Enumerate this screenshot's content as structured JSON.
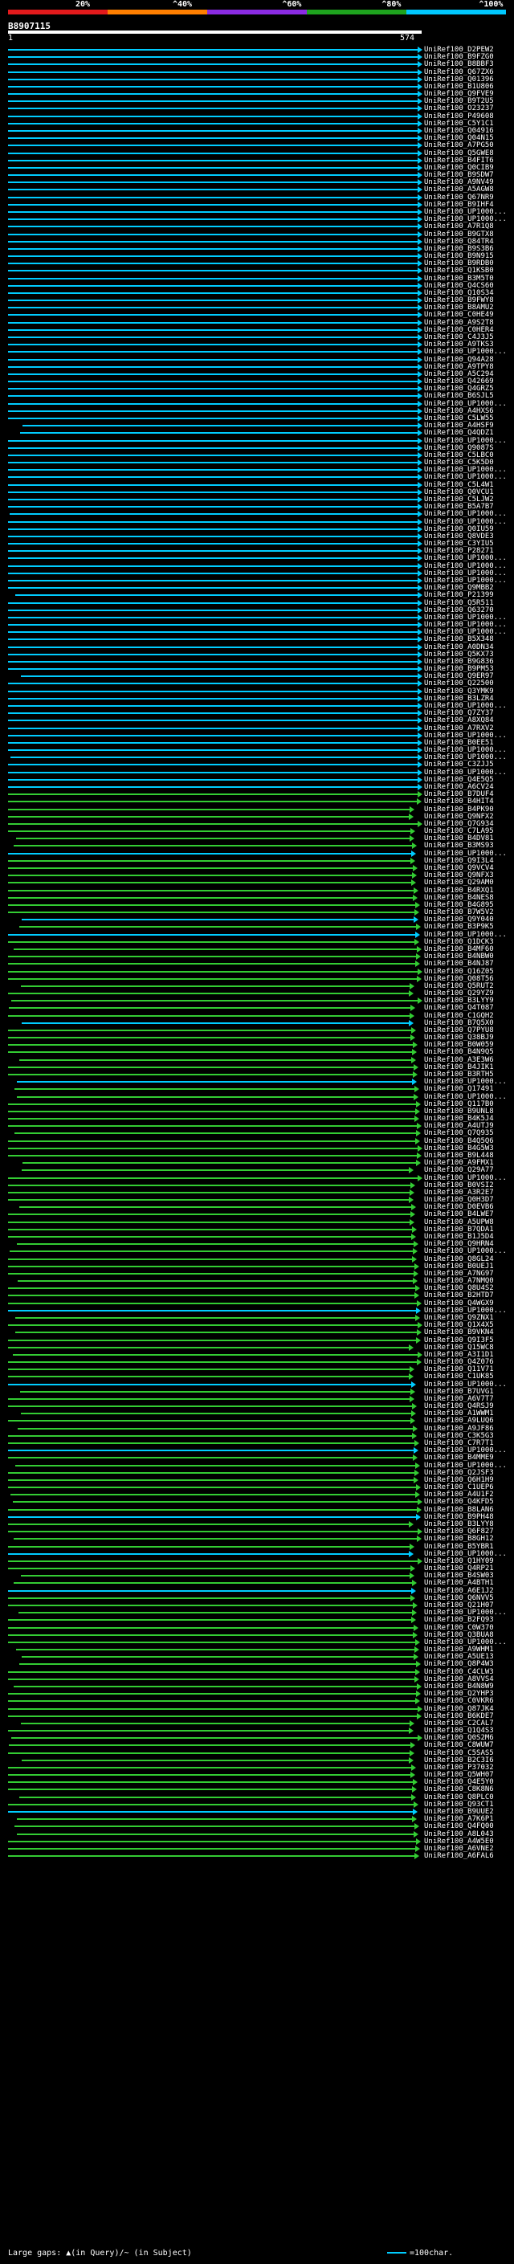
{
  "scale": {
    "ticks": [
      "20%",
      "^40%",
      "^60%",
      "^80%",
      "^100%"
    ],
    "segments": [
      {
        "color": "#e31a1c"
      },
      {
        "color": "#ff7f00"
      },
      {
        "color": "#8a2be2"
      },
      {
        "color": "#1ea31e"
      },
      {
        "color": "#00c8ff"
      }
    ]
  },
  "query": {
    "id": "B8907115",
    "start": "1",
    "end": "574"
  },
  "legend": {
    "left": "Large gaps: ▲(in Query)/~ (in Subject)",
    "right": "=100char."
  },
  "hits": [
    {
      "label": "UniRef100_D2PEW2",
      "color": "#00ccff"
    },
    {
      "label": "UniRef100_B9FZG0",
      "color": "#00ccff"
    },
    {
      "label": "UniRef100_B8BBF3",
      "color": "#00ccff"
    },
    {
      "label": "UniRef100_Q67ZX6",
      "color": "#00ccff"
    },
    {
      "label": "UniRef100_Q01396",
      "color": "#00ccff"
    },
    {
      "label": "UniRef100_B1U806",
      "color": "#00ccff"
    },
    {
      "label": "UniRef100_Q9FVE9",
      "color": "#00ccff"
    },
    {
      "label": "UniRef100_B9T2U5",
      "color": "#00ccff"
    },
    {
      "label": "UniRef100_O23237",
      "color": "#00ccff"
    },
    {
      "label": "UniRef100_P49608",
      "color": "#00ccff"
    },
    {
      "label": "UniRef100_C5Y1C1",
      "color": "#00ccff"
    },
    {
      "label": "UniRef100_Q04916",
      "color": "#00ccff"
    },
    {
      "label": "UniRef100_Q04N15",
      "color": "#00ccff"
    },
    {
      "label": "UniRef100_A7PG50",
      "color": "#00ccff"
    },
    {
      "label": "UniRef100_Q5GWE8",
      "color": "#00ccff"
    },
    {
      "label": "UniRef100_B4FIT6",
      "color": "#00ccff"
    },
    {
      "label": "UniRef100_Q0CIB9",
      "color": "#00ccff"
    },
    {
      "label": "UniRef100_B9SDW7",
      "color": "#00ccff"
    },
    {
      "label": "UniRef100_A9NV49",
      "color": "#00ccff"
    },
    {
      "label": "UniRef100_A5AGW8",
      "color": "#00ccff"
    },
    {
      "label": "UniRef100_Q67NR9",
      "color": "#00ccff"
    },
    {
      "label": "UniRef100_B9IHF4",
      "color": "#00ccff"
    },
    {
      "label": "UniRef100_UP1000...",
      "color": "#00ccff"
    },
    {
      "label": "UniRef100_UP1000...",
      "color": "#00ccff"
    },
    {
      "label": "UniRef100_A7R1Q8",
      "color": "#00ccff"
    },
    {
      "label": "UniRef100_B9GTX8",
      "color": "#00ccff"
    },
    {
      "label": "UniRef100_Q84TR4",
      "color": "#00ccff"
    },
    {
      "label": "UniRef100_B9S3B6",
      "color": "#00ccff"
    },
    {
      "label": "UniRef100_B9N915",
      "color": "#00ccff"
    },
    {
      "label": "UniRef100_B9RDB0",
      "color": "#00ccff"
    },
    {
      "label": "UniRef100_Q1KSB0",
      "color": "#00ccff"
    },
    {
      "label": "UniRef100_B3M5T0",
      "color": "#00ccff"
    },
    {
      "label": "UniRef100_Q4CS60",
      "color": "#00ccff"
    },
    {
      "label": "UniRef100_Q10S34",
      "color": "#00ccff"
    },
    {
      "label": "UniRef100_B9FWY8",
      "color": "#00ccff"
    },
    {
      "label": "UniRef100_B8AMU2",
      "color": "#00ccff"
    },
    {
      "label": "UniRef100_C0HE49",
      "color": "#00ccff"
    },
    {
      "label": "UniRef100_A9S2T8",
      "color": "#00ccff"
    },
    {
      "label": "UniRef100_C0HER4",
      "color": "#00ccff"
    },
    {
      "label": "UniRef100_C4J3J5",
      "color": "#00ccff"
    },
    {
      "label": "UniRef100_A9TKS3",
      "color": "#00ccff"
    },
    {
      "label": "UniRef100_UP1000...",
      "color": "#00ccff"
    },
    {
      "label": "UniRef100_Q94A28",
      "color": "#00ccff"
    },
    {
      "label": "UniRef100_A9TPY8",
      "color": "#00ccff"
    },
    {
      "label": "UniRef100_A5C294",
      "color": "#00ccff"
    },
    {
      "label": "UniRef100_Q42669",
      "color": "#00ccff"
    },
    {
      "label": "UniRef100_Q4GRZ5",
      "color": "#00ccff"
    },
    {
      "label": "UniRef100_B6SJL5",
      "color": "#00ccff"
    },
    {
      "label": "UniRef100_UP1000...",
      "color": "#00ccff"
    },
    {
      "label": "UniRef100_A4HXS6",
      "color": "#00ccff"
    },
    {
      "label": "UniRef100_C5LW55",
      "color": "#00ccff"
    },
    {
      "label": "UniRef100_A4HSF9",
      "color": "#00ccff"
    },
    {
      "label": "UniRef100_Q4QDZ1",
      "color": "#00ccff"
    },
    {
      "label": "UniRef100_UP1000...",
      "color": "#00ccff"
    },
    {
      "label": "UniRef100_Q9087S",
      "color": "#00ccff"
    },
    {
      "label": "UniRef100_C5LBC0",
      "color": "#00ccff"
    },
    {
      "label": "UniRef100_C5K5D0",
      "color": "#00ccff"
    },
    {
      "label": "UniRef100_UP1000...",
      "color": "#00ccff"
    },
    {
      "label": "UniRef100_UP1000...",
      "color": "#00ccff"
    },
    {
      "label": "UniRef100_C5L4W1",
      "color": "#00ccff"
    },
    {
      "label": "UniRef100_Q0VCU1",
      "color": "#00ccff"
    },
    {
      "label": "UniRef100_C5LJW2",
      "color": "#00ccff"
    },
    {
      "label": "UniRef100_B5A7B7",
      "color": "#00ccff"
    },
    {
      "label": "UniRef100_UP1000...",
      "color": "#00ccff"
    },
    {
      "label": "UniRef100_UP1000...",
      "color": "#00ccff"
    },
    {
      "label": "UniRef100_Q0IU59",
      "color": "#00ccff"
    },
    {
      "label": "UniRef100_Q8VDE3",
      "color": "#00ccff"
    },
    {
      "label": "UniRef100_C3YIU5",
      "color": "#00ccff"
    },
    {
      "label": "UniRef100_P28271",
      "color": "#00ccff"
    },
    {
      "label": "UniRef100_UP1000...",
      "color": "#00ccff"
    },
    {
      "label": "UniRef100_UP1000...",
      "color": "#00ccff"
    },
    {
      "label": "UniRef100_UP1000...",
      "color": "#00ccff"
    },
    {
      "label": "UniRef100_UP1000...",
      "color": "#00ccff"
    },
    {
      "label": "UniRef100_Q9MBB2",
      "color": "#00ccff"
    },
    {
      "label": "UniRef100_P21399",
      "color": "#00ccff"
    },
    {
      "label": "UniRef100_Q5R511",
      "color": "#00ccff"
    },
    {
      "label": "UniRef100_Q63270",
      "color": "#00ccff"
    },
    {
      "label": "UniRef100_UP1000...",
      "color": "#00ccff"
    },
    {
      "label": "UniRef100_UP1000...",
      "color": "#00ccff"
    },
    {
      "label": "UniRef100_UP1000...",
      "color": "#00ccff"
    },
    {
      "label": "UniRef100_B5X348",
      "color": "#00ccff"
    },
    {
      "label": "UniRef100_A0DN34",
      "color": "#00ccff"
    },
    {
      "label": "UniRef100_Q5KX73",
      "color": "#00ccff"
    },
    {
      "label": "UniRef100_B9G836",
      "color": "#00ccff"
    },
    {
      "label": "UniRef100_B9PM53",
      "color": "#00ccff"
    },
    {
      "label": "UniRef100_Q9ER97",
      "color": "#00ccff"
    },
    {
      "label": "UniRef100_Q22500",
      "color": "#00ccff"
    },
    {
      "label": "UniRef100_Q3YMK9",
      "color": "#00ccff"
    },
    {
      "label": "UniRef100_B3LZR4",
      "color": "#00ccff"
    },
    {
      "label": "UniRef100_UP1000...",
      "color": "#00ccff"
    },
    {
      "label": "UniRef100_Q7ZY37",
      "color": "#00ccff"
    },
    {
      "label": "UniRef100_A8XQ84",
      "color": "#00ccff"
    },
    {
      "label": "UniRef100_A7RXV2",
      "color": "#00ccff"
    },
    {
      "label": "UniRef100_UP1000...",
      "color": "#00ccff"
    },
    {
      "label": "UniRef100_B0EE51",
      "color": "#00ccff"
    },
    {
      "label": "UniRef100_UP1000...",
      "color": "#00ccff"
    },
    {
      "label": "UniRef100_UP1000...",
      "color": "#00ccff"
    },
    {
      "label": "UniRef100_C3ZJJ5",
      "color": "#00ccff"
    },
    {
      "label": "UniRef100_UP1000...",
      "color": "#00ccff"
    },
    {
      "label": "UniRef100_Q4E5Q5",
      "color": "#00ccff"
    },
    {
      "label": "UniRef100_A6CV24",
      "color": "#00ccff"
    },
    {
      "label": "UniRef100_B7DUF4",
      "color": "#33cc33"
    },
    {
      "label": "UniRef100_B4HIT4",
      "color": "#33cc33"
    },
    {
      "label": "UniRef100_B4PK90",
      "color": "#33cc33"
    },
    {
      "label": "UniRef100_Q9NFX2",
      "color": "#33cc33"
    },
    {
      "label": "UniRef100_Q7G934",
      "color": "#33cc33"
    },
    {
      "label": "UniRef100_C7LA95",
      "color": "#33cc33"
    },
    {
      "label": "UniRef100_B4DV81",
      "color": "#33cc33"
    },
    {
      "label": "UniRef100_B3MS93",
      "color": "#33cc33"
    },
    {
      "label": "UniRef100_UP1000...",
      "color": "#00ccff"
    },
    {
      "label": "UniRef100_Q9I3L4",
      "color": "#33cc33"
    },
    {
      "label": "UniRef100_Q9VCV4",
      "color": "#33cc33"
    },
    {
      "label": "UniRef100_Q9NFX3",
      "color": "#33cc33"
    },
    {
      "label": "UniRef100_Q29AM0",
      "color": "#33cc33"
    },
    {
      "label": "UniRef100_B4RXQ1",
      "color": "#33cc33"
    },
    {
      "label": "UniRef100_B4NES8",
      "color": "#33cc33"
    },
    {
      "label": "UniRef100_B4G895",
      "color": "#33cc33"
    },
    {
      "label": "UniRef100_B7W5V2",
      "color": "#33cc33"
    },
    {
      "label": "UniRef100_Q9Y040",
      "color": "#00ccff"
    },
    {
      "label": "UniRef100_B3P9K5",
      "color": "#33cc33"
    },
    {
      "label": "UniRef100_UP1000...",
      "color": "#00ccff"
    },
    {
      "label": "UniRef100_Q1DCK3",
      "color": "#33cc33"
    },
    {
      "label": "UniRef100_B4MF60",
      "color": "#33cc33"
    },
    {
      "label": "UniRef100_B4NBW0",
      "color": "#33cc33"
    },
    {
      "label": "UniRef100_B4NJ87",
      "color": "#33cc33"
    },
    {
      "label": "UniRef100_Q16Z05",
      "color": "#33cc33"
    },
    {
      "label": "UniRef100_Q08T56",
      "color": "#33cc33"
    },
    {
      "label": "UniRef100_Q5RUT2",
      "color": "#33cc33"
    },
    {
      "label": "UniRef100_Q29YZ9",
      "color": "#33cc33"
    },
    {
      "label": "UniRef100_B3LYY9",
      "color": "#33cc33"
    },
    {
      "label": "UniRef100_Q4T087",
      "color": "#33cc33"
    },
    {
      "label": "UniRef100_C1GQH2",
      "color": "#33cc33"
    },
    {
      "label": "UniRef100_B7Q5X0",
      "color": "#00ccff"
    },
    {
      "label": "UniRef100_Q7PYU8",
      "color": "#33cc33"
    },
    {
      "label": "UniRef100_Q38BJ9",
      "color": "#33cc33"
    },
    {
      "label": "UniRef100_B0W059",
      "color": "#33cc33"
    },
    {
      "label": "UniRef100_B4N9Q5",
      "color": "#33cc33"
    },
    {
      "label": "UniRef100_A3E3W6",
      "color": "#33cc33"
    },
    {
      "label": "UniRef100_B4JIK1",
      "color": "#33cc33"
    },
    {
      "label": "UniRef100_B3RTH5",
      "color": "#33cc33"
    },
    {
      "label": "UniRef100_UP1000...",
      "color": "#00ccff"
    },
    {
      "label": "UniRef100_Q17491",
      "color": "#33cc33"
    },
    {
      "label": "UniRef100_UP1000...",
      "color": "#33cc33"
    },
    {
      "label": "UniRef100_Q117B0",
      "color": "#33cc33"
    },
    {
      "label": "UniRef100_B9UNL8",
      "color": "#33cc33"
    },
    {
      "label": "UniRef100_B4K5J4",
      "color": "#33cc33"
    },
    {
      "label": "UniRef100_A4UTJ9",
      "color": "#33cc33"
    },
    {
      "label": "UniRef100_Q7Q935",
      "color": "#33cc33"
    },
    {
      "label": "UniRef100_B4Q5Q6",
      "color": "#33cc33"
    },
    {
      "label": "UniRef100_B4G5W3",
      "color": "#33cc33"
    },
    {
      "label": "UniRef100_B9L448",
      "color": "#33cc33"
    },
    {
      "label": "UniRef100_A9FMX1",
      "color": "#33cc33"
    },
    {
      "label": "UniRef100_Q29A77",
      "color": "#33cc33"
    },
    {
      "label": "UniRef100_UP1000...",
      "color": "#33cc33"
    },
    {
      "label": "UniRef100_B0VSI2",
      "color": "#33cc33"
    },
    {
      "label": "UniRef100_A3R2E7",
      "color": "#33cc33"
    },
    {
      "label": "UniRef100_Q0H3D7",
      "color": "#33cc33"
    },
    {
      "label": "UniRef100_D0EVB6",
      "color": "#33cc33"
    },
    {
      "label": "UniRef100_B4LWE7",
      "color": "#33cc33"
    },
    {
      "label": "UniRef100_A5UPW8",
      "color": "#33cc33"
    },
    {
      "label": "UniRef100_B7QDA1",
      "color": "#33cc33"
    },
    {
      "label": "UniRef100_B1J5D4",
      "color": "#33cc33"
    },
    {
      "label": "UniRef100_Q9HRN4",
      "color": "#33cc33"
    },
    {
      "label": "UniRef100_UP1000...",
      "color": "#33cc33"
    },
    {
      "label": "UniRef100_Q8GL24",
      "color": "#33cc33"
    },
    {
      "label": "UniRef100_B0UEJ1",
      "color": "#33cc33"
    },
    {
      "label": "UniRef100_A7NG97",
      "color": "#33cc33"
    },
    {
      "label": "UniRef100_A7NMQ0",
      "color": "#33cc33"
    },
    {
      "label": "UniRef100_Q8U4S2",
      "color": "#33cc33"
    },
    {
      "label": "UniRef100_B2HTD7",
      "color": "#33cc33"
    },
    {
      "label": "UniRef100_Q4WGX9",
      "color": "#33cc33"
    },
    {
      "label": "UniRef100_UP1000...",
      "color": "#00ccff"
    },
    {
      "label": "UniRef100_Q9ZNX1",
      "color": "#33cc33"
    },
    {
      "label": "UniRef100_Q1X4X5",
      "color": "#33cc33"
    },
    {
      "label": "UniRef100_B9VKN4",
      "color": "#33cc33"
    },
    {
      "label": "UniRef100_Q9I3F5",
      "color": "#33cc33"
    },
    {
      "label": "UniRef100_Q15WC8",
      "color": "#33cc33"
    },
    {
      "label": "UniRef100_A3I1D1",
      "color": "#33cc33"
    },
    {
      "label": "UniRef100_Q4Z076",
      "color": "#33cc33"
    },
    {
      "label": "UniRef100_Q11V71",
      "color": "#33cc33"
    },
    {
      "label": "UniRef100_C1UK85",
      "color": "#33cc33"
    },
    {
      "label": "UniRef100_UP1000...",
      "color": "#00ccff"
    },
    {
      "label": "UniRef100_B7UVG1",
      "color": "#33cc33"
    },
    {
      "label": "UniRef100_A6V7T7",
      "color": "#33cc33"
    },
    {
      "label": "UniRef100_Q4RSJ9",
      "color": "#33cc33"
    },
    {
      "label": "UniRef100_A1WWM1",
      "color": "#33cc33"
    },
    {
      "label": "UniRef100_A9LUQ6",
      "color": "#33cc33"
    },
    {
      "label": "UniRef100_A9JF86",
      "color": "#33cc33"
    },
    {
      "label": "UniRef100_C3K5G3",
      "color": "#33cc33"
    },
    {
      "label": "UniRef100_C7R7T1",
      "color": "#33cc33"
    },
    {
      "label": "UniRef100_UP1000...",
      "color": "#00ccff"
    },
    {
      "label": "UniRef100_B4MME9",
      "color": "#33cc33"
    },
    {
      "label": "UniRef100_UP1000...",
      "color": "#33cc33"
    },
    {
      "label": "UniRef100_Q2JSF3",
      "color": "#33cc33"
    },
    {
      "label": "UniRef100_Q6H1H9",
      "color": "#33cc33"
    },
    {
      "label": "UniRef100_C1UEP6",
      "color": "#33cc33"
    },
    {
      "label": "UniRef100_A4U1F2",
      "color": "#33cc33"
    },
    {
      "label": "UniRef100_Q4KFD5",
      "color": "#33cc33"
    },
    {
      "label": "UniRef100_B8LAN6",
      "color": "#33cc33"
    },
    {
      "label": "UniRef100_B9PH48",
      "color": "#00ccff"
    },
    {
      "label": "UniRef100_B3LYY8",
      "color": "#33cc33"
    },
    {
      "label": "UniRef100_Q6F827",
      "color": "#33cc33"
    },
    {
      "label": "UniRef100_B8GH12",
      "color": "#33cc33"
    },
    {
      "label": "UniRef100_B5YBR1",
      "color": "#33cc33"
    },
    {
      "label": "UniRef100_UP1000...",
      "color": "#00ccff"
    },
    {
      "label": "UniRef100_Q1HY09",
      "color": "#33cc33"
    },
    {
      "label": "UniRef100_Q4RP21",
      "color": "#33cc33"
    },
    {
      "label": "UniRef100_B4SW03",
      "color": "#33cc33"
    },
    {
      "label": "UniRef100_A4BTH1",
      "color": "#33cc33"
    },
    {
      "label": "UniRef100_A6E1J2",
      "color": "#00ccff"
    },
    {
      "label": "UniRef100_Q6NVV5",
      "color": "#33cc33"
    },
    {
      "label": "UniRef100_Q21H07",
      "color": "#33cc33"
    },
    {
      "label": "UniRef100_UP1000...",
      "color": "#33cc33"
    },
    {
      "label": "UniRef100_B2FQ93",
      "color": "#33cc33"
    },
    {
      "label": "UniRef100_C0W370",
      "color": "#33cc33"
    },
    {
      "label": "UniRef100_Q3BUA8",
      "color": "#33cc33"
    },
    {
      "label": "UniRef100_UP1000...",
      "color": "#33cc33"
    },
    {
      "label": "UniRef100_A9WHM1",
      "color": "#33cc33"
    },
    {
      "label": "UniRef100_A5UE13",
      "color": "#33cc33"
    },
    {
      "label": "UniRef100_Q8P4W3",
      "color": "#33cc33"
    },
    {
      "label": "UniRef100_C4CLW3",
      "color": "#33cc33"
    },
    {
      "label": "UniRef100_A8VVS4",
      "color": "#33cc33"
    },
    {
      "label": "UniRef100_B4N8W9",
      "color": "#33cc33"
    },
    {
      "label": "UniRef100_Q2YHP3",
      "color": "#33cc33"
    },
    {
      "label": "UniRef100_C0VKR6",
      "color": "#33cc33"
    },
    {
      "label": "UniRef100_Q87JK4",
      "color": "#33cc33"
    },
    {
      "label": "UniRef100_B6KDE7",
      "color": "#33cc33"
    },
    {
      "label": "UniRef100_C2CAL7",
      "color": "#33cc33"
    },
    {
      "label": "UniRef100_Q1Q4S3",
      "color": "#33cc33"
    },
    {
      "label": "UniRef100_Q0S2M6",
      "color": "#33cc33"
    },
    {
      "label": "UniRef100_C8WUW7",
      "color": "#33cc33"
    },
    {
      "label": "UniRef100_C5SAS5",
      "color": "#33cc33"
    },
    {
      "label": "UniRef100_B2C3I6",
      "color": "#33cc33"
    },
    {
      "label": "UniRef100_P37032",
      "color": "#33cc33"
    },
    {
      "label": "UniRef100_Q5WH07",
      "color": "#33cc33"
    },
    {
      "label": "UniRef100_Q4E5Y0",
      "color": "#33cc33"
    },
    {
      "label": "UniRef100_C8K8N6",
      "color": "#33cc33"
    },
    {
      "label": "UniRef100_Q8PLC0",
      "color": "#33cc33"
    },
    {
      "label": "UniRef100_Q93CT1",
      "color": "#33cc33"
    },
    {
      "label": "UniRef100_B9UUE2",
      "color": "#00ccff"
    },
    {
      "label": "UniRef100_A7K6P1",
      "color": "#33cc33"
    },
    {
      "label": "UniRef100_Q4FQ00",
      "color": "#33cc33"
    },
    {
      "label": "UniRef100_A8L043",
      "color": "#33cc33"
    },
    {
      "label": "UniRef100_A4W5E0",
      "color": "#33cc33"
    },
    {
      "label": "UniRef100_A6VNE2",
      "color": "#33cc33"
    },
    {
      "label": "UniRef100_A6FAL6",
      "color": "#33cc33"
    }
  ]
}
